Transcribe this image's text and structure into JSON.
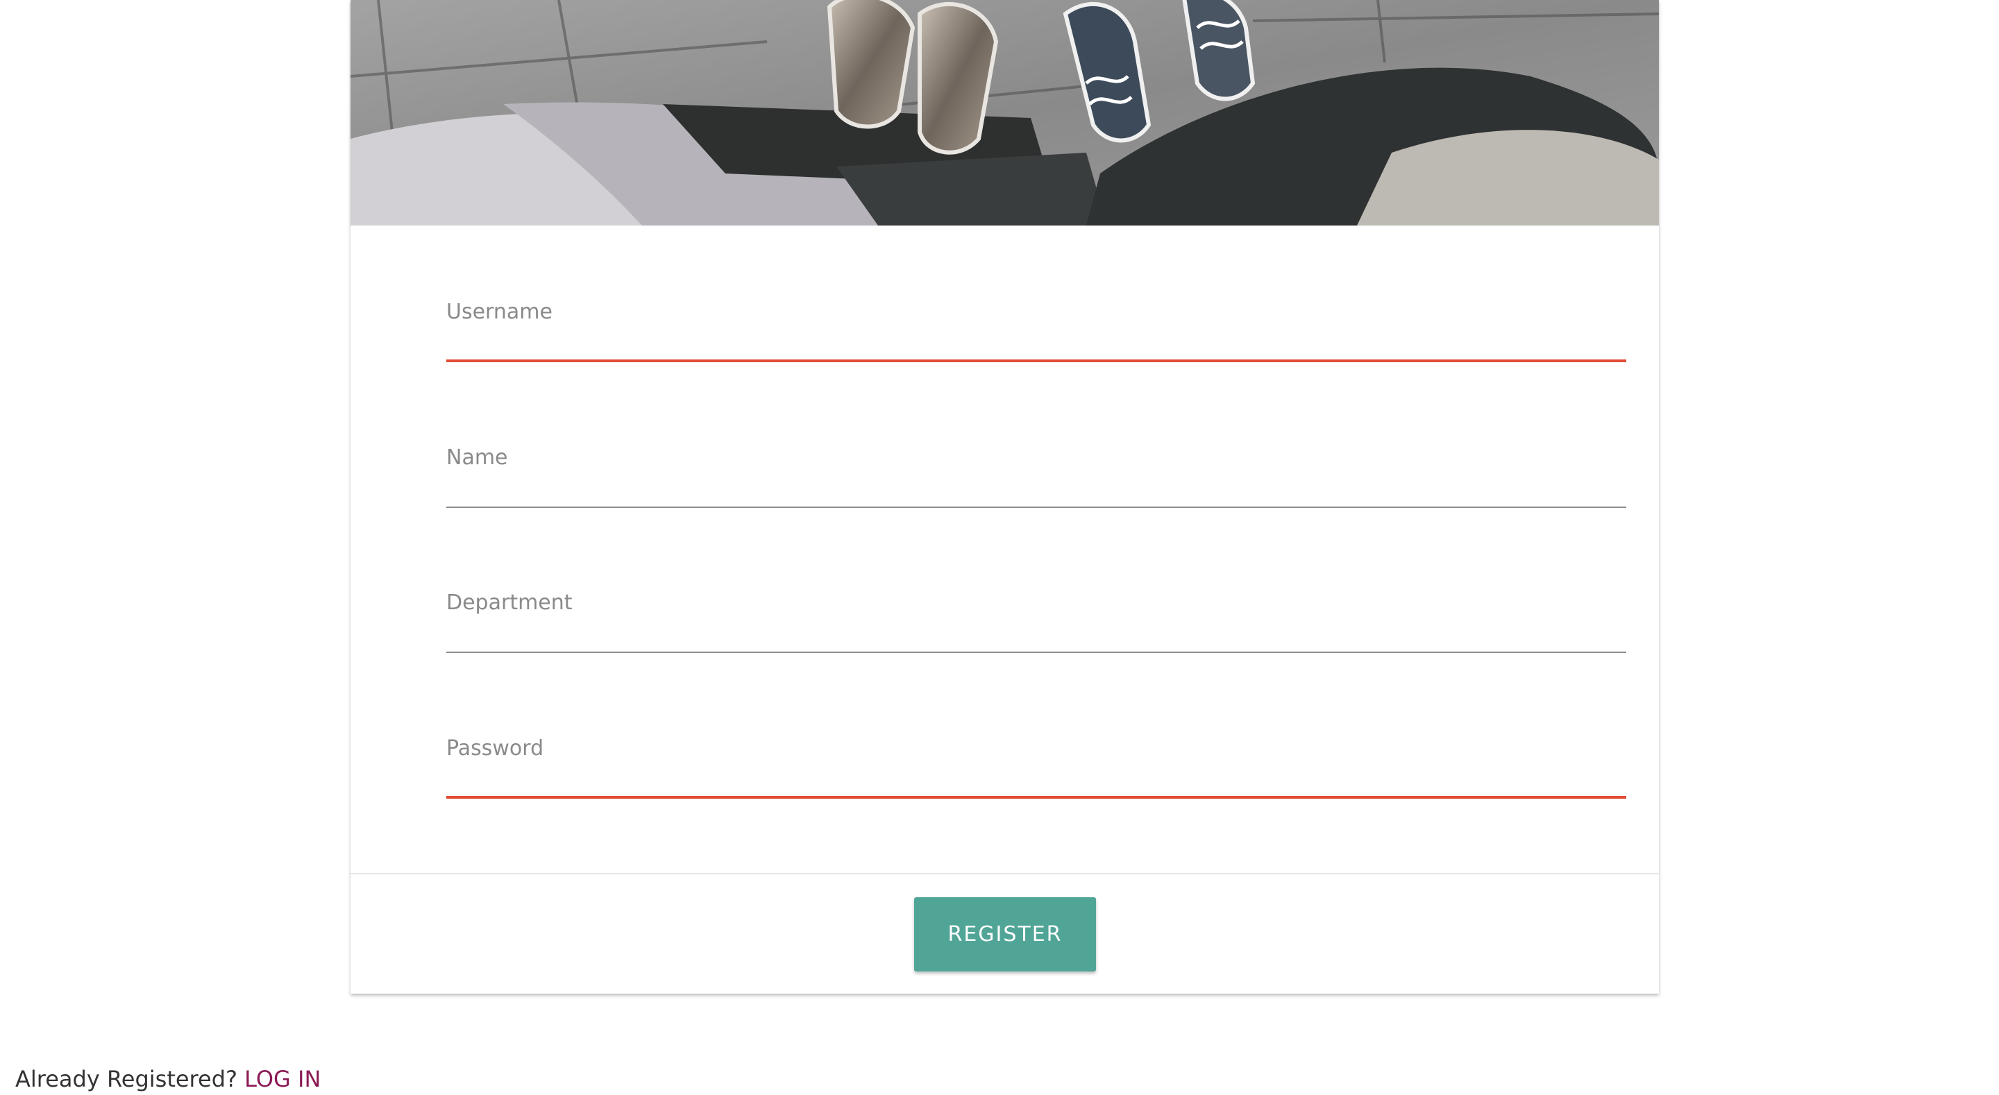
{
  "hero": {
    "image": "sneakers-on-pavement-photo"
  },
  "form": {
    "fields": [
      {
        "label": "Username",
        "state": "invalid"
      },
      {
        "label": "Name",
        "state": "default"
      },
      {
        "label": "Department",
        "state": "default"
      },
      {
        "label": "Password",
        "state": "invalid"
      }
    ],
    "submit_label": "REGISTER"
  },
  "footer": {
    "prompt": "Already Registered?",
    "login_link": "LOG IN"
  },
  "colors": {
    "accent": "#51a597",
    "error_underline": "#e24b36",
    "link": "#8b1a55",
    "placeholder": "#8a8a8a"
  }
}
